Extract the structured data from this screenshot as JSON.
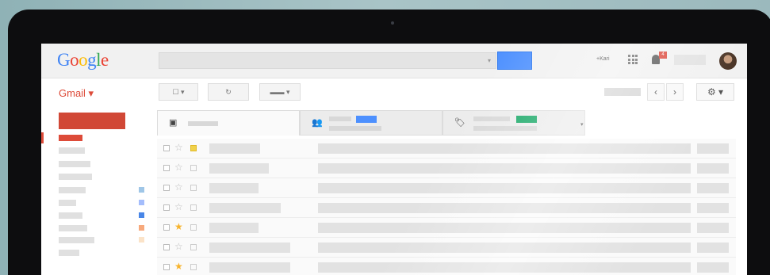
{
  "header": {
    "logo_letters": [
      "G",
      "o",
      "o",
      "g",
      "l",
      "e"
    ],
    "user_name": "+Kari",
    "notification_count": "4"
  },
  "toolbar": {
    "mail_label": "Gmail ▾",
    "select_label": "☐ ▾",
    "refresh_label": "↻",
    "more_label": "▬▬ ▾",
    "newer_label": "‹",
    "older_label": "›",
    "settings_label": "⚙ ▾"
  },
  "tabs": {
    "primary_icon": "inbox-icon",
    "social_icon": "people-icon",
    "promotions_icon": "tag-icon",
    "social_chip_color": "#4d90fe",
    "promotions_chip_color": "#16a765"
  },
  "sidebar": {
    "label_colors": [
      "#9fc6e7",
      "#a4bdfc",
      "#4986e7",
      "#f7a97c",
      "#fbe3c8"
    ]
  },
  "rows": [
    {
      "starred": false,
      "important": true
    },
    {
      "starred": false,
      "important": false
    },
    {
      "starred": false,
      "important": false
    },
    {
      "starred": false,
      "important": false
    },
    {
      "starred": true,
      "important": false
    },
    {
      "starred": false,
      "important": false
    },
    {
      "starred": true,
      "important": false
    }
  ],
  "colors": {
    "accent_red": "#dd4b39",
    "search_blue": "#4d90fe",
    "star_yellow": "#f7b32b"
  }
}
